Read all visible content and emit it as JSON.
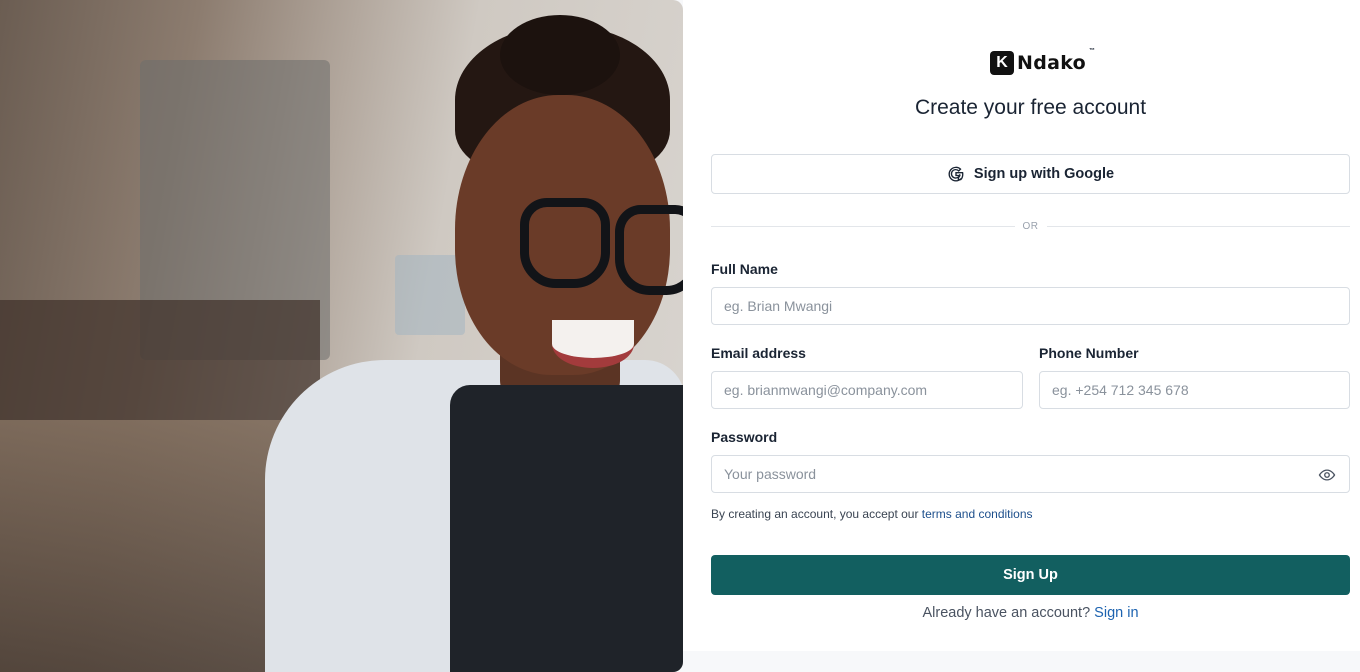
{
  "brand": {
    "logo_letter": "K",
    "logo_word": "Ndako",
    "logo_tm": "™"
  },
  "page": {
    "title": "Create your free account"
  },
  "google": {
    "label": "Sign up with Google",
    "icon": "google-g-icon"
  },
  "divider": {
    "text": "OR"
  },
  "form": {
    "full_name": {
      "label": "Full Name",
      "placeholder": "eg. Brian Mwangi",
      "value": ""
    },
    "email": {
      "label": "Email address",
      "placeholder": "eg. brianmwangi@company.com",
      "value": ""
    },
    "phone": {
      "label": "Phone Number",
      "placeholder": "eg. +254 712 345 678",
      "value": ""
    },
    "password": {
      "label": "Password",
      "placeholder": "Your password",
      "value": "",
      "toggle_icon": "eye-icon"
    }
  },
  "terms": {
    "prefix": "By creating an account, you accept our ",
    "link": "terms and conditions"
  },
  "submit": {
    "label": "Sign Up"
  },
  "signin": {
    "prefix": "Already have an account? ",
    "link": "Sign in"
  },
  "colors": {
    "primary": "#125f60",
    "link": "#1d63b0",
    "border": "#d8dde3"
  }
}
